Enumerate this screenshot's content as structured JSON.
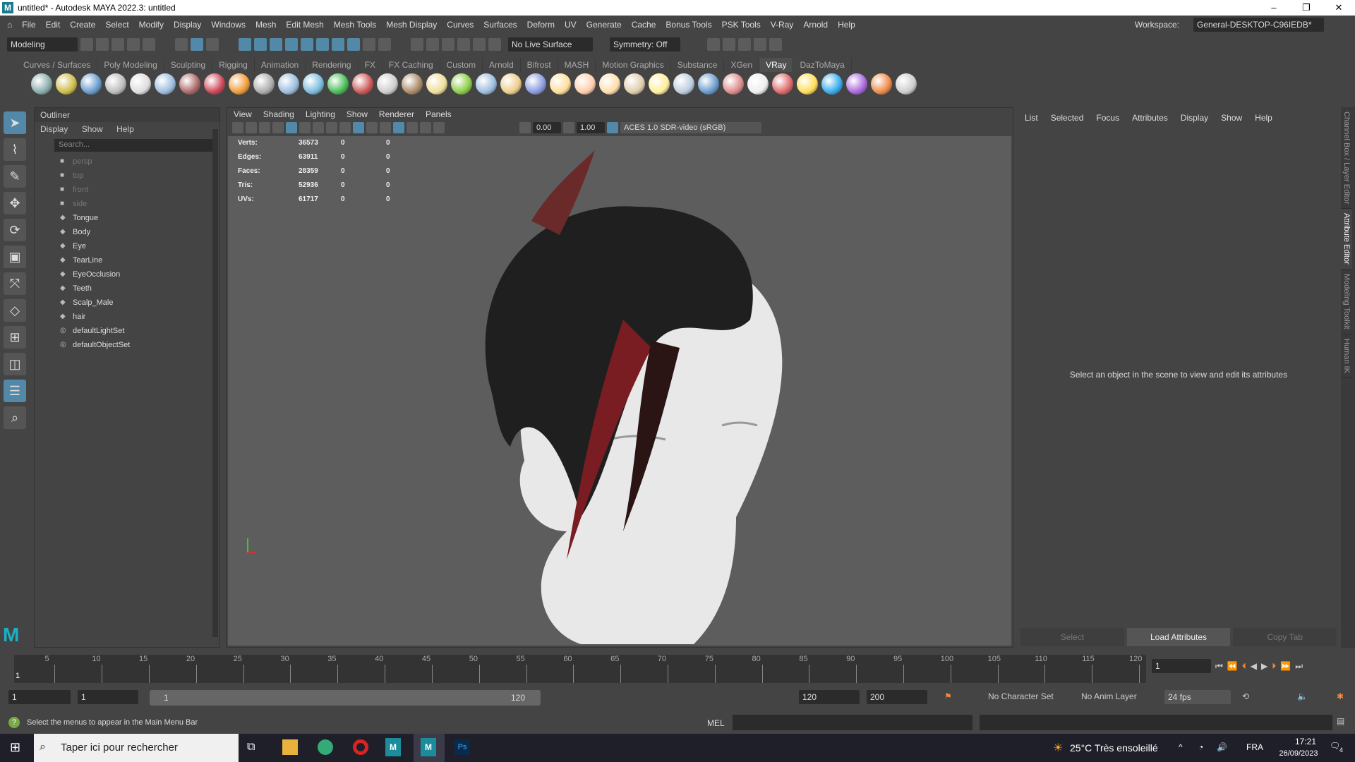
{
  "window": {
    "title": "untitled* - Autodesk MAYA 2022.3: untitled",
    "logo": "M",
    "controls": [
      "–",
      "❐",
      "✕"
    ]
  },
  "menubar": [
    "File",
    "Edit",
    "Create",
    "Select",
    "Modify",
    "Display",
    "Windows",
    "Mesh",
    "Edit Mesh",
    "Mesh Tools",
    "Mesh Display",
    "Curves",
    "Surfaces",
    "Deform",
    "UV",
    "Generate",
    "Cache",
    "Bonus Tools",
    "PSK Tools",
    "V-Ray",
    "Arnold",
    "Help"
  ],
  "workspace": {
    "label": "Workspace:",
    "value": "General-DESKTOP-C96IEDB*"
  },
  "statusline": {
    "mode": "Modeling",
    "live_surface": "No Live Surface",
    "symmetry": "Symmetry: Off"
  },
  "shelf_tabs": [
    "Curves / Surfaces",
    "Poly Modeling",
    "Sculpting",
    "Rigging",
    "Animation",
    "Rendering",
    "FX",
    "FX Caching",
    "Custom",
    "Arnold",
    "Bifrost",
    "MASH",
    "Motion Graphics",
    "Substance",
    "XGen",
    "VRay",
    "DazToMaya"
  ],
  "active_shelf_tab": "VRay",
  "shelf_icon_colors": [
    "#8aa",
    "#cb4",
    "#69c",
    "#bbb",
    "#ddd",
    "#9bd",
    "#a66",
    "#c45",
    "#e93",
    "#aaa",
    "#9bd",
    "#7bd",
    "#4b5",
    "#c55",
    "#ccc",
    "#a86",
    "#ed9",
    "#8c4",
    "#9bd",
    "#ec8",
    "#89d",
    "#fd9",
    "#fca",
    "#fda",
    "#dca",
    "#fe9",
    "#bcd",
    "#69c",
    "#d88",
    "#eee",
    "#d66",
    "#fd5",
    "#3ae",
    "#a6d",
    "#e84",
    "#ccc"
  ],
  "outliner": {
    "title": "Outliner",
    "menus": [
      "Display",
      "Show",
      "Help"
    ],
    "search_placeholder": "Search...",
    "items": [
      {
        "name": "persp",
        "type": "camera",
        "dim": true
      },
      {
        "name": "top",
        "type": "camera",
        "dim": true
      },
      {
        "name": "front",
        "type": "camera",
        "dim": true
      },
      {
        "name": "side",
        "type": "camera",
        "dim": true
      },
      {
        "name": "Tongue",
        "type": "mesh"
      },
      {
        "name": "Body",
        "type": "mesh"
      },
      {
        "name": "Eye",
        "type": "mesh"
      },
      {
        "name": "TearLine",
        "type": "mesh"
      },
      {
        "name": "EyeOcclusion",
        "type": "mesh"
      },
      {
        "name": "Teeth",
        "type": "mesh"
      },
      {
        "name": "Scalp_Male",
        "type": "mesh"
      },
      {
        "name": "hair",
        "type": "mesh"
      },
      {
        "name": "defaultLightSet",
        "type": "set"
      },
      {
        "name": "defaultObjectSet",
        "type": "set"
      }
    ]
  },
  "viewport": {
    "menus": [
      "View",
      "Shading",
      "Lighting",
      "Show",
      "Renderer",
      "Panels"
    ],
    "exposure": "0.00",
    "gamma": "1.00",
    "color_space": "ACES 1.0 SDR-video (sRGB)",
    "hud": [
      [
        "Verts:",
        "36573",
        "0",
        "0"
      ],
      [
        "Edges:",
        "63911",
        "0",
        "0"
      ],
      [
        "Faces:",
        "28359",
        "0",
        "0"
      ],
      [
        "Tris:",
        "52936",
        "0",
        "0"
      ],
      [
        "UVs:",
        "61717",
        "0",
        "0"
      ]
    ]
  },
  "attribute_editor": {
    "menus": [
      "List",
      "Selected",
      "Focus",
      "Attributes",
      "Display",
      "Show",
      "Help"
    ],
    "message": "Select an object in the scene to view and edit its attributes",
    "buttons": [
      "Select",
      "Load Attributes",
      "Copy Tab"
    ]
  },
  "side_tabs": [
    "Channel Box / Layer Editor",
    "Attribute Editor",
    "Modeling Toolkit",
    "Human IK"
  ],
  "timeline": {
    "ticks": [
      "5",
      "10",
      "15",
      "20",
      "25",
      "30",
      "35",
      "40",
      "45",
      "50",
      "55",
      "60",
      "65",
      "70",
      "75",
      "80",
      "85",
      "90",
      "95",
      "100",
      "105",
      "110",
      "115",
      "120"
    ],
    "current_frame": "1",
    "current_field": "1"
  },
  "range": {
    "start": "1",
    "anim_start": "1",
    "slider_start": "1",
    "slider_end": "120",
    "end": "120",
    "anim_end": "200",
    "character_set": "No Character Set",
    "anim_layer": "No Anim Layer",
    "fps": "24 fps"
  },
  "command": {
    "help": "Select the menus to appear in the Main Menu Bar",
    "lang": "MEL"
  },
  "taskbar": {
    "search": "Taper ici pour rechercher",
    "weather": "25°C  Très ensoleillé",
    "lang": "FRA",
    "time": "17:21",
    "date": "26/09/2023",
    "notifications": "4"
  }
}
